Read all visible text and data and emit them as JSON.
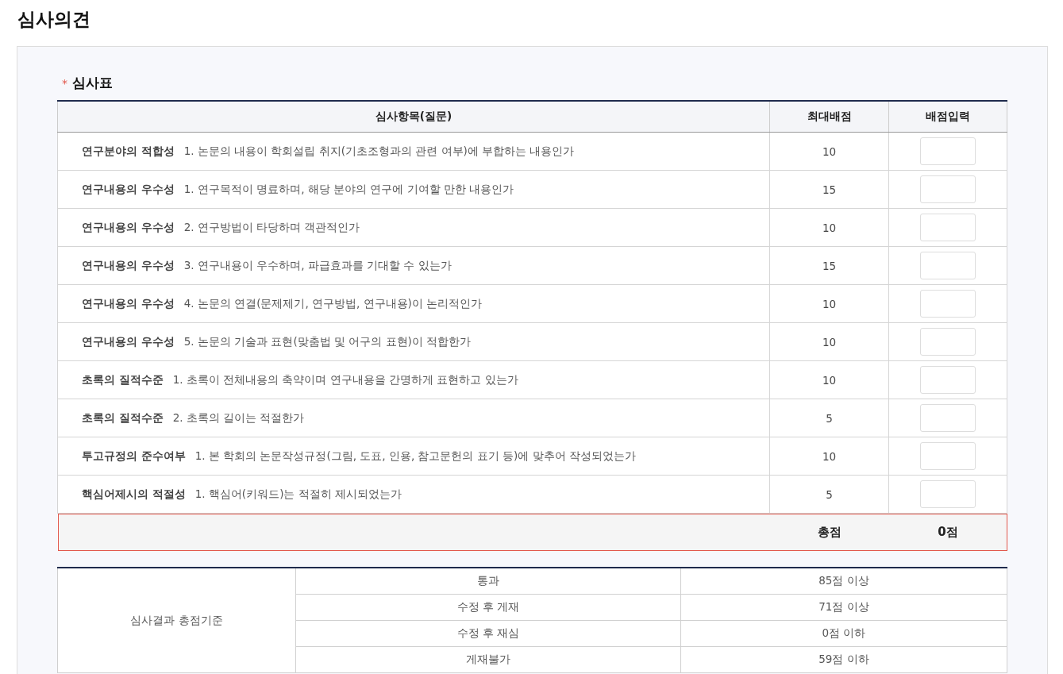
{
  "page_title": "심사의견",
  "section": {
    "required_mark": "*",
    "title": "심사표"
  },
  "table": {
    "columns": [
      "심사항목(질문)",
      "최대배점",
      "배점입력"
    ],
    "rows": [
      {
        "category": "연구분야의 적합성",
        "question": "1. 논문의 내용이 학회설립 취지(기초조형과의 관련 여부)에 부합하는 내용인가",
        "max_score": "10"
      },
      {
        "category": "연구내용의 우수성",
        "question": "1. 연구목적이 명료하며, 해당 분야의 연구에 기여할 만한 내용인가",
        "max_score": "15"
      },
      {
        "category": "연구내용의 우수성",
        "question": "2. 연구방법이 타당하며 객관적인가",
        "max_score": "10"
      },
      {
        "category": "연구내용의 우수성",
        "question": "3. 연구내용이 우수하며, 파급효과를 기대할 수 있는가",
        "max_score": "15"
      },
      {
        "category": "연구내용의 우수성",
        "question": "4. 논문의 연결(문제제기, 연구방법, 연구내용)이 논리적인가",
        "max_score": "10"
      },
      {
        "category": "연구내용의 우수성",
        "question": "5. 논문의 기술과 표현(맞춤법 및 어구의 표현)이 적합한가",
        "max_score": "10"
      },
      {
        "category": "초록의 질적수준",
        "question": "1. 초록이 전체내용의 축약이며 연구내용을 간명하게 표현하고 있는가",
        "max_score": "10"
      },
      {
        "category": "초록의 질적수준",
        "question": "2. 초록의 길이는 적절한가",
        "max_score": "5"
      },
      {
        "category": "투고규정의 준수여부",
        "question": "1. 본 학회의 논문작성규정(그림, 도표, 인용, 참고문헌의 표기 등)에 맞추어 작성되었는가",
        "max_score": "10"
      },
      {
        "category": "핵심어제시의 적절성",
        "question": "1. 핵심어(키워드)는 적절히 제시되었는가",
        "max_score": "5"
      }
    ],
    "total": {
      "label": "총점",
      "value": "0점"
    }
  },
  "criteria": {
    "label": "심사결과 총점기준",
    "rows": [
      {
        "result": "통과",
        "threshold": "85점 이상"
      },
      {
        "result": "수정 후 게재",
        "threshold": "71점 이상"
      },
      {
        "result": "수정 후 재심",
        "threshold": "0점 이하"
      },
      {
        "result": "게재불가",
        "threshold": "59점 이하"
      }
    ]
  }
}
